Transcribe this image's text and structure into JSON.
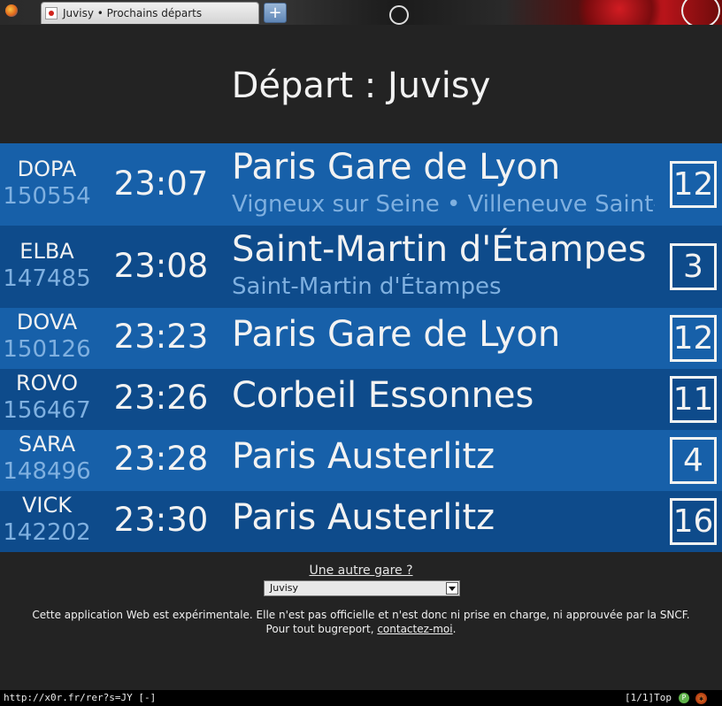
{
  "browser": {
    "tab_title": "Juvisy • Prochains départs",
    "new_tab_label": "+",
    "status_url": "http://x0r.fr/rer?s=JY [-]",
    "status_position": "[1/1]Top",
    "status_badge": "P",
    "status_addon_icon": "bug-icon"
  },
  "page": {
    "title": "Départ : Juvisy"
  },
  "departures": [
    {
      "mission": "DOPA",
      "train_number": "150554",
      "time": "23:07",
      "destination": "Paris Gare de Lyon",
      "stops": "Vigneux sur Seine • Villeneuve Saint-",
      "track": "12"
    },
    {
      "mission": "ELBA",
      "train_number": "147485",
      "time": "23:08",
      "destination": "Saint-Martin d'Étampes",
      "stops": "Saint-Martin d'Étampes",
      "track": "3"
    },
    {
      "mission": "DOVA",
      "train_number": "150126",
      "time": "23:23",
      "destination": "Paris Gare de Lyon",
      "stops": "",
      "track": "12"
    },
    {
      "mission": "ROVO",
      "train_number": "156467",
      "time": "23:26",
      "destination": "Corbeil Essonnes",
      "stops": "",
      "track": "11"
    },
    {
      "mission": "SARA",
      "train_number": "148496",
      "time": "23:28",
      "destination": "Paris Austerlitz",
      "stops": "",
      "track": "4"
    },
    {
      "mission": "VICK",
      "train_number": "142202",
      "time": "23:30",
      "destination": "Paris Austerlitz",
      "stops": "",
      "track": "16"
    }
  ],
  "station_picker": {
    "prompt": "Une autre gare ?",
    "selected": "Juvisy"
  },
  "footer": {
    "disclaimer": "Cette application Web est expérimentale. Elle n'est pas officielle et n'est donc ni prise en charge, ni approuvée par la SNCF.",
    "bugreport_prefix": "Pour tout bugreport, ",
    "contact_link": "contactez-moi",
    "bugreport_suffix": "."
  },
  "colors": {
    "background": "#232323",
    "row_light": "#1760a9",
    "row_dark": "#0e4b8b",
    "secondary_text": "#7fb0e0"
  }
}
